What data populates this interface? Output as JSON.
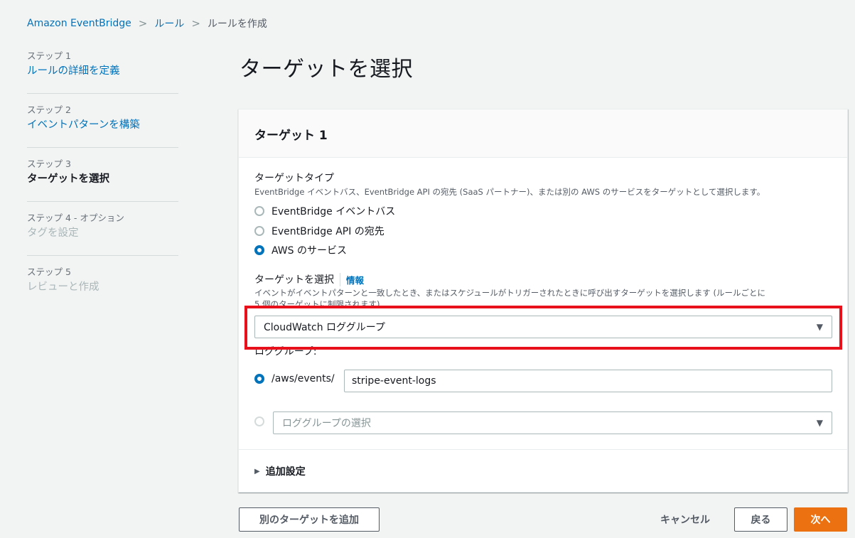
{
  "breadcrumb": {
    "items": [
      "Amazon EventBridge",
      "ルール",
      "ルールを作成"
    ],
    "separator": ">"
  },
  "steps": [
    {
      "num": "ステップ 1",
      "title": "ルールの詳細を定義",
      "state": "link"
    },
    {
      "num": "ステップ 2",
      "title": "イベントパターンを構築",
      "state": "link"
    },
    {
      "num": "ステップ 3",
      "title": "ターゲットを選択",
      "state": "active"
    },
    {
      "num": "ステップ 4 - オプション",
      "title": "タグを設定",
      "state": "disabled"
    },
    {
      "num": "ステップ 5",
      "title": "レビューと作成",
      "state": "disabled"
    }
  ],
  "page_title": "ターゲットを選択",
  "panel": {
    "title": "ターゲット 1",
    "target_type": {
      "label": "ターゲットタイプ",
      "description": "EventBridge イベントバス、EventBridge API の宛先 (SaaS パートナー)、または別の AWS のサービスをターゲットとして選択します。",
      "options": [
        {
          "label": "EventBridge イベントバス",
          "checked": false
        },
        {
          "label": "EventBridge API の宛先",
          "checked": false
        },
        {
          "label": "AWS のサービス",
          "checked": true
        }
      ]
    },
    "select_target": {
      "label": "ターゲットを選択",
      "info": "情報",
      "description_line1": "イベントがイベントパターンと一致したとき、またはスケジュールがトリガーされたときに呼び出すターゲットを選択します (ルールごとに",
      "description_line2": "5 個のターゲットに制限されます)",
      "value": "CloudWatch ロググループ"
    },
    "log_group": {
      "label": "ロググループ:",
      "prefix": "/aws/events/",
      "name_value": "stripe-event-logs",
      "select_placeholder": "ロググループの選択"
    },
    "additional_settings": "追加設定"
  },
  "buttons": {
    "add_target": "別のターゲットを追加",
    "cancel": "キャンセル",
    "back": "戻る",
    "next": "次へ"
  },
  "colors": {
    "link": "#0073bb",
    "primary": "#ec7211",
    "highlight": "#e8101a"
  }
}
